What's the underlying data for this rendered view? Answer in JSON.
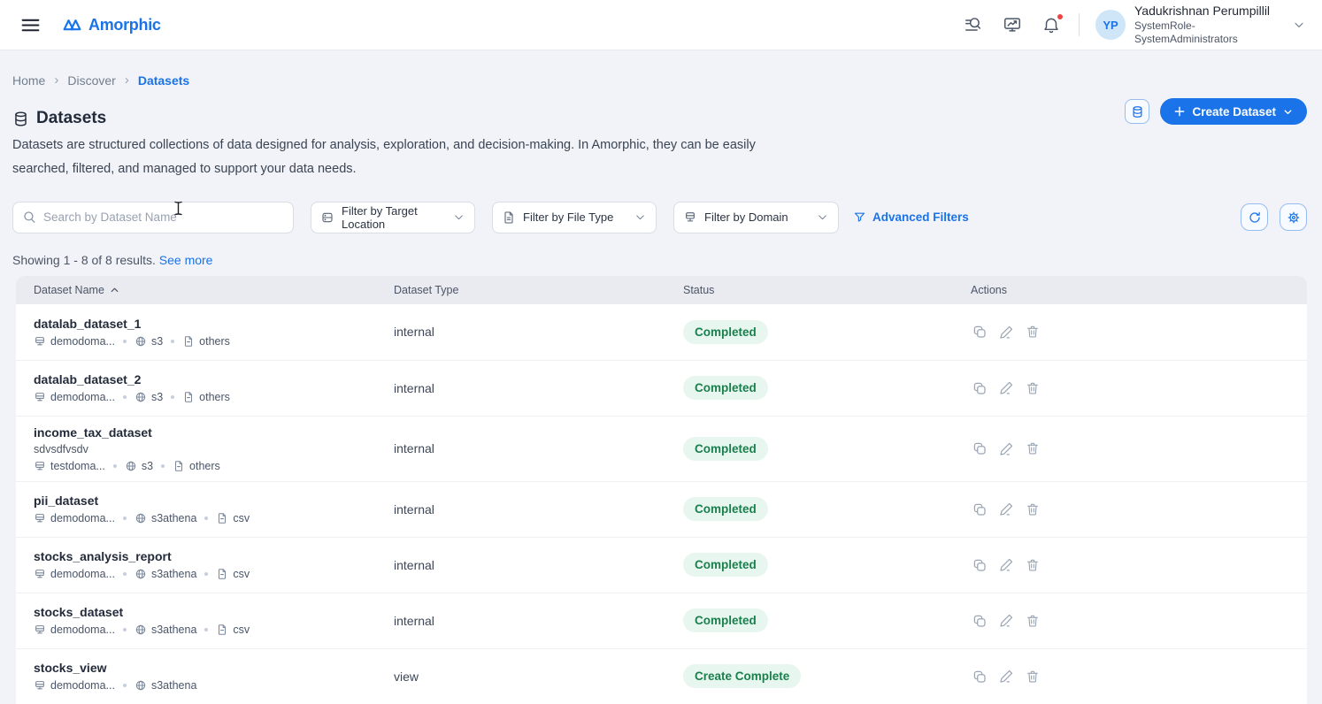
{
  "topbar": {
    "brand": "Amorphic",
    "user": {
      "initials": "YP",
      "name": "Yadukrishnan Perumpillil",
      "role": "SystemRole-SystemAdministrators"
    }
  },
  "breadcrumb": {
    "items": [
      "Home",
      "Discover",
      "Datasets"
    ]
  },
  "page_header": {
    "title": "Datasets",
    "description": "Datasets are structured collections of data designed for analysis, exploration, and decision-making. In Amorphic, they can be easily searched, filtered, and managed to support your data needs.",
    "create_button_label": "Create Dataset"
  },
  "filters": {
    "search_placeholder": "Search by Dataset Name",
    "target_location_label": "Filter by Target Location",
    "file_type_label": "Filter by File Type",
    "domain_label": "Filter by Domain",
    "advanced_filters_label": "Advanced Filters"
  },
  "results": {
    "summary": "Showing 1 - 8 of 8 results.",
    "see_more_label": "See more"
  },
  "table": {
    "columns": [
      "Dataset Name",
      "Dataset Type",
      "Status",
      "Actions"
    ],
    "rows": [
      {
        "name": "datalab_dataset_1",
        "description": "",
        "domain": "demodoma...",
        "target_location": "s3",
        "file_type": "others",
        "dataset_type": "internal",
        "status": "Completed"
      },
      {
        "name": "datalab_dataset_2",
        "description": "",
        "domain": "demodoma...",
        "target_location": "s3",
        "file_type": "others",
        "dataset_type": "internal",
        "status": "Completed"
      },
      {
        "name": "income_tax_dataset",
        "description": "sdvsdfvsdv",
        "domain": "testdoma...",
        "target_location": "s3",
        "file_type": "others",
        "dataset_type": "internal",
        "status": "Completed"
      },
      {
        "name": "pii_dataset",
        "description": "",
        "domain": "demodoma...",
        "target_location": "s3athena",
        "file_type": "csv",
        "dataset_type": "internal",
        "status": "Completed"
      },
      {
        "name": "stocks_analysis_report",
        "description": "",
        "domain": "demodoma...",
        "target_location": "s3athena",
        "file_type": "csv",
        "dataset_type": "internal",
        "status": "Completed"
      },
      {
        "name": "stocks_dataset",
        "description": "",
        "domain": "demodoma...",
        "target_location": "s3athena",
        "file_type": "csv",
        "dataset_type": "internal",
        "status": "Completed"
      },
      {
        "name": "stocks_view",
        "description": "",
        "domain": "demodoma...",
        "target_location": "s3athena",
        "file_type": "",
        "dataset_type": "view",
        "status": "Create Complete"
      }
    ]
  },
  "icons": [
    "menu-icon",
    "amorphic-logo-icon",
    "global-search-icon",
    "dashboard-icon",
    "notifications-bell-icon",
    "chevron-down-icon",
    "datasets-title-icon",
    "database-icon",
    "plus-icon",
    "search-icon",
    "target-location-icon",
    "file-icon",
    "domain-icon",
    "funnel-icon",
    "refresh-icon",
    "gear-icon",
    "sort-asc-icon",
    "globe-grid-icon",
    "copy-icon",
    "edit-icon",
    "delete-icon",
    "text-cursor"
  ],
  "colors": {
    "accent_blue": "#1a73e8",
    "status_green_text": "#1b7f4d",
    "status_green_bg": "#e7f6ee",
    "notification_dot": "#ef4444",
    "page_background": "#f1f3f8",
    "table_header_bg": "#e9ebf1"
  }
}
